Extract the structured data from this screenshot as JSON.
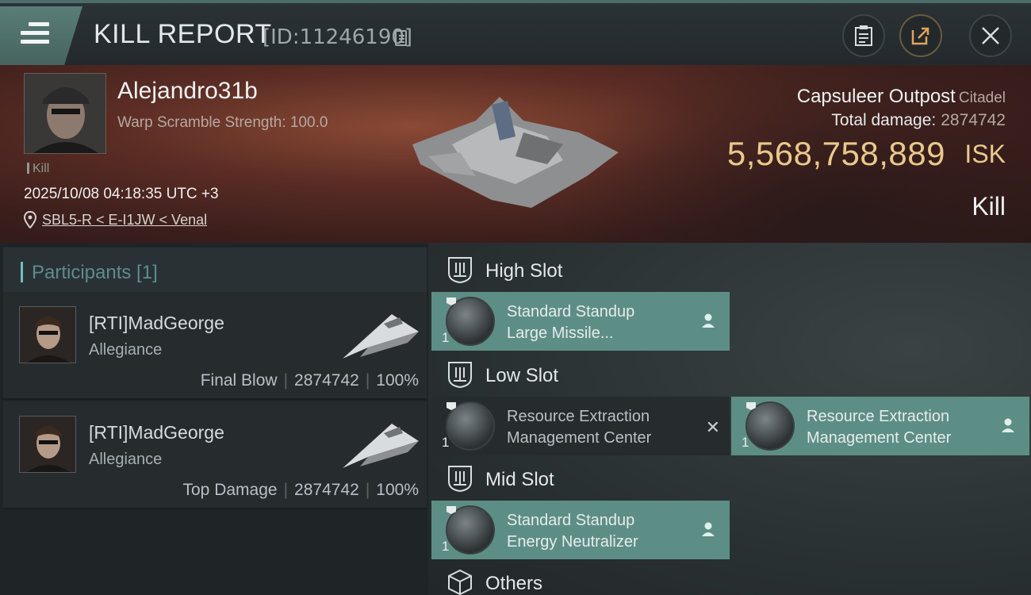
{
  "header": {
    "title": "KILL REPORT",
    "report_id": "[ID:11246190]"
  },
  "victim": {
    "name": "Alejandro31b",
    "subtitle": "Warp Scramble Strength: 100.0",
    "kill_tag": "Kill",
    "timestamp": "2025/10/08 04:18:35 UTC +3",
    "location": "SBL5-R < E-I1JW < Venal"
  },
  "summary": {
    "structure": "Capsuleer Outpost",
    "structure_class": "Citadel",
    "total_damage_label": "Total damage:",
    "total_damage_value": "2874742",
    "isk_value": "5,568,758,889",
    "isk_label": "ISK",
    "result": "Kill"
  },
  "participants": {
    "header": "Participants [1]",
    "list": [
      {
        "name": "[RTI]MadGeorge",
        "ship": "Allegiance",
        "role": "Final Blow",
        "damage": "2874742",
        "percent": "100%"
      },
      {
        "name": "[RTI]MadGeorge",
        "ship": "Allegiance",
        "role": "Top Damage",
        "damage": "2874742",
        "percent": "100%"
      }
    ]
  },
  "fitting": {
    "high_slot": {
      "label": "High Slot",
      "modules": [
        {
          "line1": "Standard Standup",
          "line2": "Large Missile...",
          "qty": "1"
        }
      ]
    },
    "low_slot": {
      "label": "Low Slot",
      "modules": [
        {
          "line1": "Resource Extraction",
          "line2": "Management Center",
          "qty": "1"
        },
        {
          "line1": "Resource Extraction",
          "line2": "Management Center",
          "qty": "1"
        }
      ]
    },
    "mid_slot": {
      "label": "Mid Slot",
      "modules": [
        {
          "line1": "Standard Standup",
          "line2": "Energy Neutralizer",
          "qty": "1"
        }
      ]
    },
    "others": {
      "label": "Others"
    }
  },
  "icons": {
    "menu": "hamburger-icon",
    "copy": "copy-icon",
    "clipboard": "clipboard-icon",
    "share": "share-icon",
    "close": "close-icon",
    "location": "pin-icon",
    "slot": "slot-icon",
    "person": "person-icon",
    "destroyed": "x-icon"
  },
  "colors": {
    "accent": "#5d8e85",
    "isk": "#e9c98b",
    "participants_header": "#5d8d8b"
  }
}
